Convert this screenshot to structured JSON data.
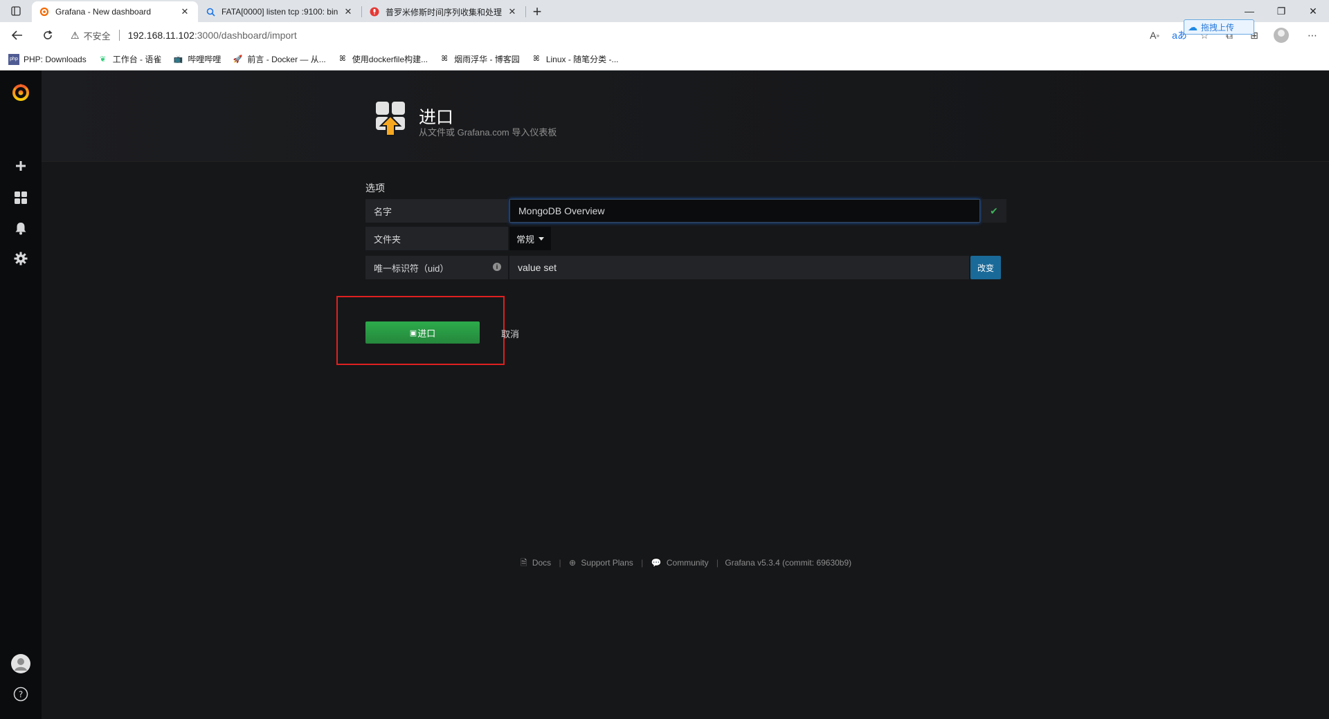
{
  "browser": {
    "tabs": [
      {
        "title": "Grafana - New dashboard",
        "icon": "grafana-icon",
        "active": true
      },
      {
        "title": "FATA[0000] listen tcp :9100: bind",
        "icon": "search-icon",
        "active": false
      },
      {
        "title": "普罗米修斯时间序列收集和处理",
        "icon": "mic-icon",
        "active": false
      }
    ],
    "address": {
      "warning": "不安全",
      "host": "192.168.11.102",
      "path": ":3000/dashboard/import"
    },
    "upload_badge": "拖拽上传",
    "bookmarks": [
      {
        "label": "PHP: Downloads",
        "icon": "php-icon"
      },
      {
        "label": "工作台 - 语雀",
        "icon": "yuque-icon"
      },
      {
        "label": "哔哩哔哩",
        "icon": "bilibili-icon"
      },
      {
        "label": "前言 - Docker — 从...",
        "icon": "rocket-icon"
      },
      {
        "label": "使用dockerfile构建...",
        "icon": "cnblogs-icon"
      },
      {
        "label": "烟雨浮华 - 博客园",
        "icon": "cnblogs-icon"
      },
      {
        "label": "Linux - 随笔分类 -...",
        "icon": "cnblogs-icon"
      }
    ]
  },
  "header": {
    "title": "进口",
    "subtitle": "从文件或 Grafana.com 导入仪表板"
  },
  "options": {
    "section_title": "选项",
    "name_label": "名字",
    "name_value": "MongoDB Overview",
    "folder_label": "文件夹",
    "folder_value": "常规",
    "uid_label": "唯一标识符（uid）",
    "uid_value": "value set",
    "change_label": "改变"
  },
  "actions": {
    "import_label": "进口",
    "cancel_label": "取消"
  },
  "footer": {
    "docs": "Docs",
    "support": "Support Plans",
    "community": "Community",
    "version": "Grafana v5.3.4 (commit: 69630b9)"
  },
  "colors": {
    "accent_green": "#2cab4b",
    "change_blue": "#1a6a99",
    "highlight_red": "#e02020"
  }
}
